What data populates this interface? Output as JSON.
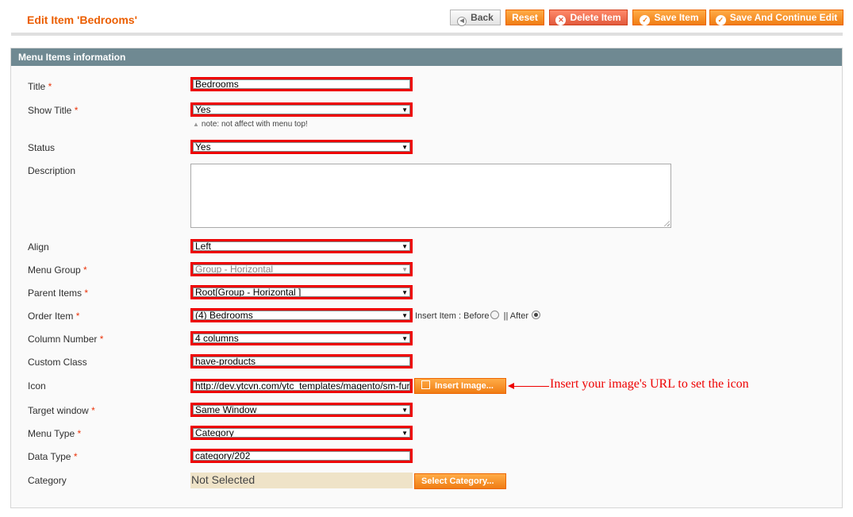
{
  "header": {
    "title": "Edit Item 'Bedrooms'",
    "buttons": {
      "back": "Back",
      "reset": "Reset",
      "delete": "Delete Item",
      "save": "Save Item",
      "save_continue": "Save And Continue Edit"
    }
  },
  "section": {
    "title": "Menu Items information"
  },
  "fields": {
    "title": {
      "label": "Title",
      "value": "Bedrooms"
    },
    "show_title": {
      "label": "Show Title",
      "value": "Yes",
      "note": "note: not affect with menu top!"
    },
    "status": {
      "label": "Status",
      "value": "Yes"
    },
    "description": {
      "label": "Description",
      "value": ""
    },
    "align": {
      "label": "Align",
      "value": "Left"
    },
    "menu_group": {
      "label": "Menu Group",
      "value": "Group - Horizontal"
    },
    "parent_items": {
      "label": "Parent Items",
      "value": "Root[Group - Horizontal ]"
    },
    "order_item": {
      "label": "Order Item",
      "value": "(4) Bedrooms",
      "insert_label": "Insert Item : Before",
      "after_label": "|| After",
      "selected": "After"
    },
    "column_number": {
      "label": "Column Number",
      "value": "4 columns"
    },
    "custom_class": {
      "label": "Custom Class",
      "value": "have-products"
    },
    "icon": {
      "label": "Icon",
      "value": "http://dev.ytcvn.com/ytc_templates/magento/sm-furn",
      "button": "Insert Image..."
    },
    "target_window": {
      "label": "Target window",
      "value": "Same Window"
    },
    "menu_type": {
      "label": "Menu Type",
      "value": "Category"
    },
    "data_type": {
      "label": "Data Type",
      "value": "category/202"
    },
    "category": {
      "label": "Category",
      "value": "Not Selected",
      "button": "Select Category..."
    }
  },
  "required_marker": "*",
  "annotation": {
    "text": "Insert your image's URL to set the icon",
    "color": "#ee0000"
  },
  "colors": {
    "title": "#eb5e00",
    "button_orange": "#f07d14",
    "legend_bg": "#6f8992",
    "highlight_border": "#ee0000"
  }
}
